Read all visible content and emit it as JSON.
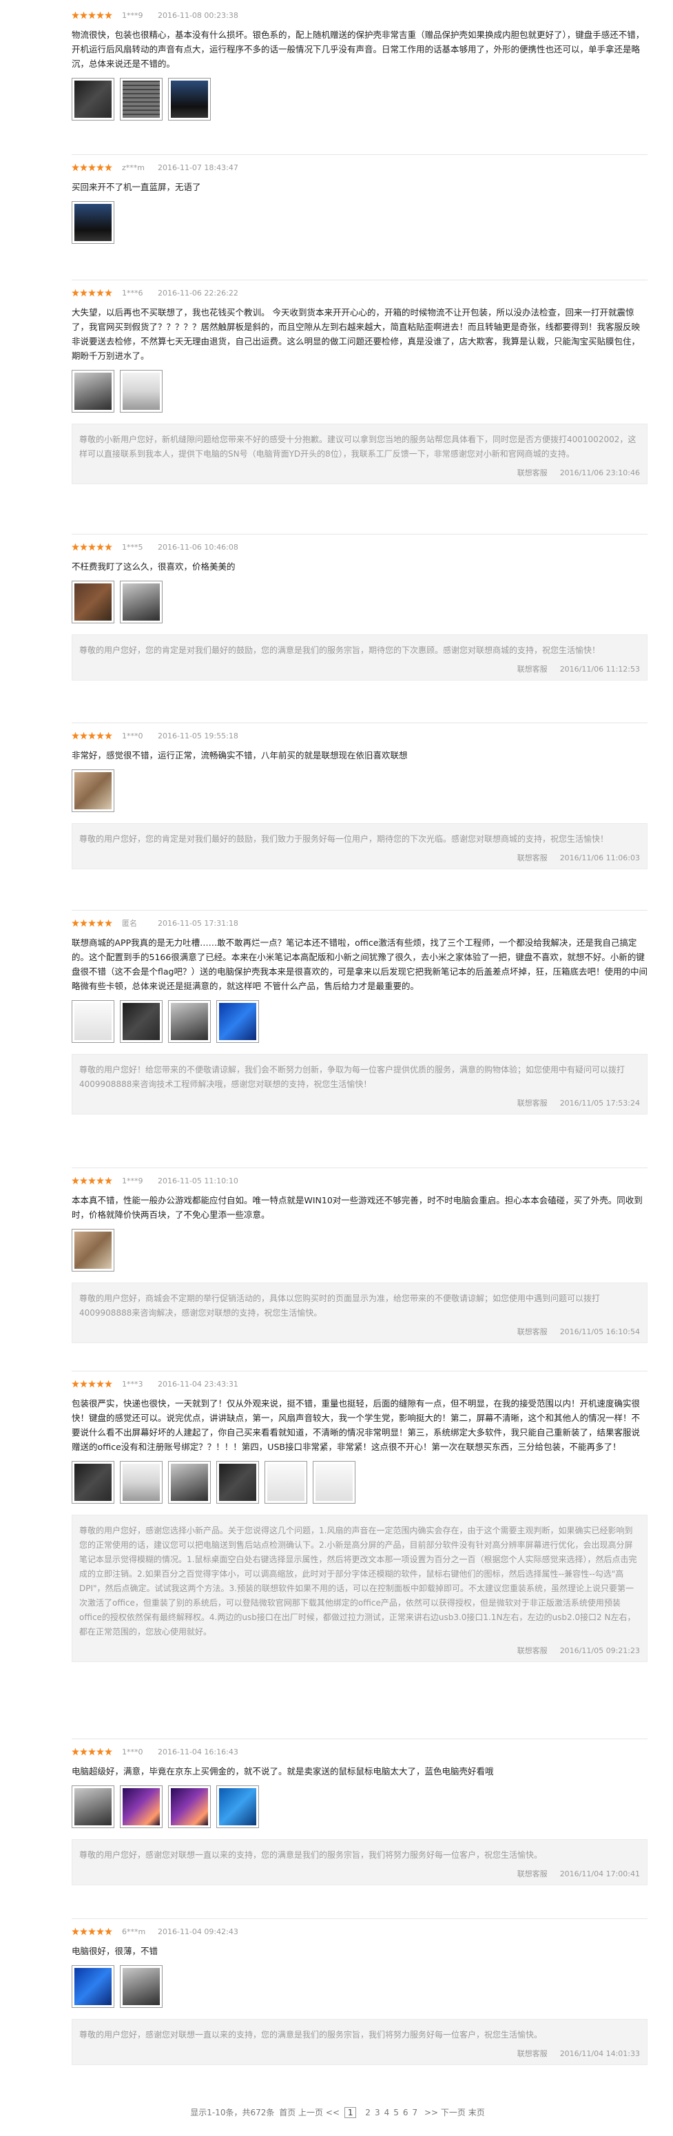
{
  "reviews": [
    {
      "stars": 5,
      "user": "1***9",
      "date": "2016-11-08 00:23:38",
      "content": "物流很快，包装也很精心，基本没有什么损坏。银色系的，配上随机赠送的保护壳非常吉重（赠品保护壳如果换成内胆包就更好了），键盘手感还不错，开机运行后风扇转动的声音有点大，运行程序不多的话一般情况下几乎没有声音。日常工作用的话基本够用了，外形的便携性也还可以，单手拿还是略沉，总体来说还是不错的。",
      "photos": [
        "g-dark",
        "g-kbd",
        "g-screen"
      ],
      "reply": null
    },
    {
      "stars": 5,
      "user": "z***m",
      "date": "2016-11-07 18:43:47",
      "content": "买回来开不了机一直蓝屏，无语了",
      "photos": [
        "g-screen"
      ],
      "reply": null
    },
    {
      "stars": 5,
      "user": "1***6",
      "date": "2016-11-06 22:26:22",
      "content": "大失望，以后再也不买联想了，我也花钱买个教训。 今天收到货本来开开心心的，开箱的时候物流不让开包装，所以没办法检查，回来一打开就震惊了，我官网买到假货了？？？？？居然触屏板是斜的，而且空隙从左到右越来越大，简直粘贴歪啊进去！而且转轴更是奇张，线都要得到！我客服反映非说要送去检修，不然算七天无理由退货，自己出运费。这么明显的做工问题还要检修，真是没谁了，店大欺客，我算是认栽，只能淘宝买贴膜包住，期盼千万别进水了。",
      "photos": [
        "g-laptop",
        "g-box"
      ],
      "reply": {
        "text": "尊敬的小新用户您好，新机缝隙问题给您带来不好的感受十分抱歉。建议可以拿到您当地的服务站帮您具体看下，同时您是否方便拨打4001002002，这样可以直接联系到我本人，提供下电脑的SN号（电脑背面YD开头的8位），我联系工厂反馈一下，非常感谢您对小新和官网商城的支持。",
        "author": "联想客服",
        "date": "2016/11/06 23:10:46"
      }
    },
    {
      "stars": 5,
      "user": "1***5",
      "date": "2016-11-06 10:46:08",
      "content": "不枉费我盯了这么久，很喜欢，价格美美的",
      "photos": [
        "g-brown",
        "g-laptop"
      ],
      "reply": {
        "text": "尊敬的用户您好，您的肯定是对我们最好的鼓励，您的满意是我们的服务宗旨，期待您的下次惠顾。感谢您对联想商城的支持，祝您生活愉快！",
        "author": "联想客服",
        "date": "2016/11/06 11:12:53"
      }
    },
    {
      "stars": 5,
      "user": "1***0",
      "date": "2016-11-05 19:55:18",
      "content": "非常好，感觉很不错，运行正常，流畅确实不错，八年前买的就是联想现在依旧喜欢联想",
      "photos": [
        "g-warm"
      ],
      "reply": {
        "text": "尊敬的用户您好，您的肯定是对我们最好的鼓励，我们致力于服务好每一位用户，期待您的下次光临。感谢您对联想商城的支持，祝您生活愉快！",
        "author": "联想客服",
        "date": "2016/11/06 11:06:03"
      }
    },
    {
      "stars": 5,
      "user": "匿名",
      "date": "2016-11-05 17:31:18",
      "content": "联想商城的APP我真的是无力吐槽……敢不敢再烂一点？笔记本还不错啦，office激活有些烦，找了三个工程师，一个都没给我解决，还是我自己搞定的。这个配置到手的5166很满意了已经。本来在小米笔记本高配版和小新之间犹豫了很久，去小米之家体验了一把，键盘不喜欢，就想不好。小新的键盘很不错（这不会是个flag吧？）送的电脑保护壳我本来是很喜欢的，可是拿来以后发现它把我新笔记本的后盖差点坏掉，狂，压箱底去吧！使用的中间略微有些卡顿，总体来说还是挺满意的，就这样吧 不管什么产品，售后给力才是最重要的。",
      "photos": [
        "g-white",
        "g-dark",
        "g-laptop",
        "g-blue"
      ],
      "reply": {
        "text": "尊敬的用户您好！给您带来的不便敬请谅解，我们会不断努力创新，争取为每一位客户提供优质的服务，满意的购物体验；如您使用中有疑问可以拨打4009908888来咨询技术工程师解决哦，感谢您对联想的支持，祝您生活愉快！",
        "author": "联想客服",
        "date": "2016/11/05 17:53:24"
      }
    },
    {
      "stars": 5,
      "user": "1***9",
      "date": "2016-11-05 11:10:10",
      "content": "本本真不错，性能一般办公游戏都能应付自如。唯一特点就是WIN10对一些游戏还不够完善，时不时电脑会重启。担心本本会磕碰，买了外壳。同收到时，价格就降价快两百块，了不免心里添一些凉意。",
      "photos": [
        "g-warm"
      ],
      "reply": {
        "text": "尊敬的用户您好，商城会不定期的举行促销活动的，具体以您购买时的页面显示为准，给您带来的不便敬请谅解；如您使用中遇到问题可以拨打4009908888来咨询解决，感谢您对联想的支持，祝您生活愉快。",
        "author": "联想客服",
        "date": "2016/11/05 16:10:54"
      }
    },
    {
      "stars": 5,
      "user": "1***3",
      "date": "2016-11-04 23:43:31",
      "content": "包装很严实，快递也很快，一天就到了！仅从外观来说，挺不错，重量也挺轻，后面的缝隙有一点，但不明显，在我的接受范围以内！开机速度确实很快！键盘的感觉还可以。说完优点，讲讲缺点，第一，风扇声音较大，我一个学生党，影响挺大的！第二，屏幕不清晰，这个和其他人的情况一样！不要说什么看不出屏幕好坏的人建起了，你自己买来看看就知道，不清晰的情况非常明显！第三，系统绑定大多软件，我只能自己重新装了，结果客服说赠送的office没有和注册账号绑定？？！！！第四，USB接口非常紧，非常紧！这点很不开心！第一次在联想买东西，三分给包装，不能再多了！",
      "photos": [
        "g-dark",
        "g-box",
        "g-laptop",
        "g-dark",
        "g-white",
        "g-white"
      ],
      "reply": {
        "text": "尊敬的用户您好，感谢您选择小新产品。关于您说得这几个问题，1.风扇的声音在一定范围内确实会存在，由于这个需要主观判断，如果确实已经影响到您的正常使用的话，建议您可以把电脑送到售后站点检测确认下。2.小新是高分屏的产品，目前部分软件没有针对高分辨率屏幕进行优化，会出现高分屏笔记本显示觉得模糊的情况。1.鼠标桌面空白处右键选择显示属性，然后将更改文本那一项设置为百分之一百（根据您个人实际感觉来选择），然后点击完成的立即注销。2.如果百分之百觉得字体小，可以调高缩放，此时对于部分字体还模糊的软件，鼠标右键他们的图标，然后选择属性--兼容性--勾选\"高DPI\"，然后点确定。试试我这两个方法。3.预装的联想软件如果不用的话，可以在控制面板中卸载掉即可。不太建议您重装系统，虽然理论上说只要第一次激活了office，但重装了别的系统后，可以登陆微软官网那下载其他绑定的office产品，依然可以获得授权，但是微软对于非正版激活系统使用预装office的授权依然保有最终解释权。4.两边的usb接口在出厂时候，都做过拉力测试，正常来讲右边usb3.0接口1.1N左右，左边的usb2.0接口2 N左右，都在正常范围的，您放心使用就好。",
        "author": "联想客服",
        "date": "2016/11/05 09:21:23"
      }
    },
    {
      "stars": 5,
      "user": "1***0",
      "date": "2016-11-04 16:16:43",
      "content": "电脑超级好，满意，毕竟在京东上买佣金的，就不说了。就是卖家送的鼠标鼠标电脑太大了，蓝色电脑壳好看哦",
      "photos": [
        "g-laptop",
        "g-purple",
        "g-purple",
        "g-win"
      ],
      "reply": {
        "text": "尊敬的用户您好，感谢您对联想一直以来的支持，您的满意是我们的服务宗旨，我们将努力服务好每一位客户，祝您生活愉快。",
        "author": "联想客服",
        "date": "2016/11/04 17:00:41"
      }
    },
    {
      "stars": 5,
      "user": "6***m",
      "date": "2016-11-04 09:42:43",
      "content": "电脑很好，很薄，不错",
      "photos": [
        "g-blue",
        "g-laptop"
      ],
      "reply": {
        "text": "尊敬的用户您好，感谢您对联想一直以来的支持，您的满意是我们的服务宗旨，我们将努力服务好每一位客户，祝您生活愉快。",
        "author": "联想客服",
        "date": "2016/11/04 14:01:33"
      }
    }
  ],
  "pagination": {
    "summary": "显示1-10条，共672条",
    "first": "首页",
    "prev": "上一页",
    "prev_arrow": "<<",
    "current": "1",
    "pages": [
      "2",
      "3",
      "4",
      "5",
      "6",
      "7"
    ],
    "next_arrow": ">>",
    "next": "下一页",
    "last": "末页"
  },
  "colors": {
    "star_on": "#f5871f",
    "star_off": "#cfcfcf",
    "reply_bg": "#f3f3f3"
  }
}
